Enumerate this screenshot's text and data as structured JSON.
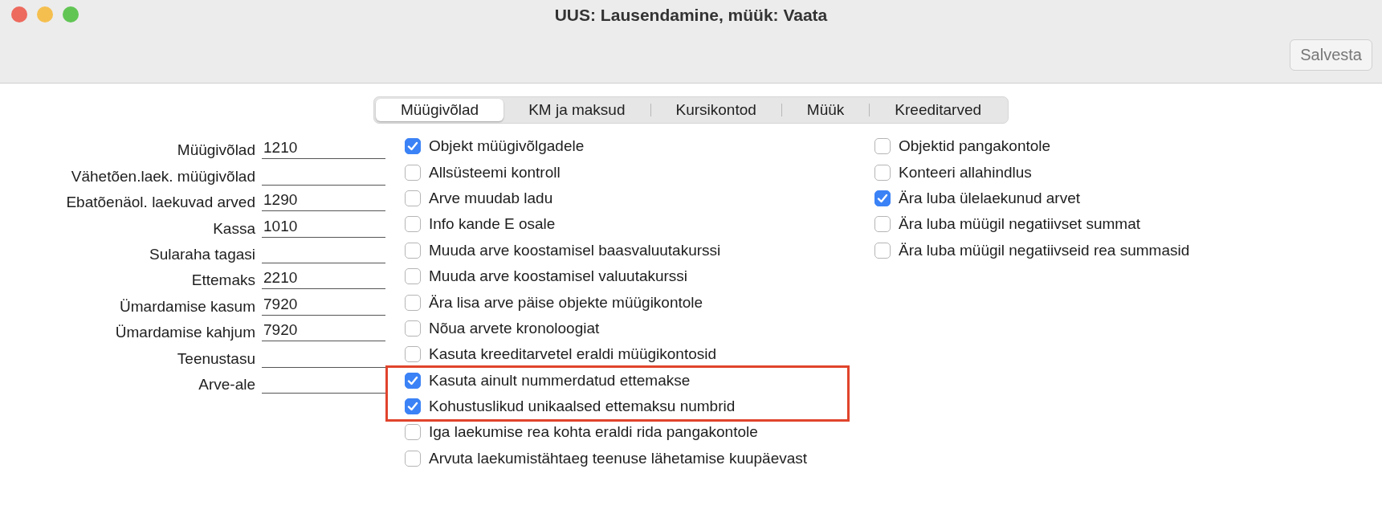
{
  "window": {
    "title": "UUS: Lausendamine, müük: Vaata"
  },
  "toolbar": {
    "save_button": "Salvesta"
  },
  "tabs": [
    {
      "label": "Müügivõlad",
      "selected": true
    },
    {
      "label": "KM ja maksud",
      "selected": false
    },
    {
      "label": "Kursikontod",
      "selected": false
    },
    {
      "label": "Müük",
      "selected": false
    },
    {
      "label": "Kreeditarved",
      "selected": false
    }
  ],
  "accounts": [
    {
      "label": "Müügivõlad",
      "value": "1210"
    },
    {
      "label": "Vähetõen.laek. müügivõlad"
    },
    {
      "label": "Ebatõenäol. laekuvad arved",
      "value": "1290"
    },
    {
      "label": "Kassa",
      "value": "1010"
    },
    {
      "label": "Sularaha tagasi"
    },
    {
      "label": "Ettemaks",
      "value": "2210"
    },
    {
      "label": "Ümardamise kasum",
      "value": "7920"
    },
    {
      "label": "Ümardamise kahjum",
      "value": "7920"
    },
    {
      "label": "Teenustasu"
    },
    {
      "label": "Arve-ale"
    }
  ],
  "options_middle": [
    {
      "label": "Objekt müügivõlgadele",
      "checked": true,
      "highlighted": false
    },
    {
      "label": "Allsüsteemi kontroll",
      "checked": false,
      "highlighted": false
    },
    {
      "label": "Arve muudab ladu",
      "checked": false,
      "highlighted": false
    },
    {
      "label": "Info kande E osale",
      "checked": false,
      "highlighted": false
    },
    {
      "label": "Muuda arve koostamisel baasvaluutakurssi",
      "checked": false,
      "highlighted": false
    },
    {
      "label": "Muuda arve koostamisel valuutakurssi",
      "checked": false,
      "highlighted": false
    },
    {
      "label": "Ära lisa arve päise objekte müügikontole",
      "checked": false,
      "highlighted": false
    },
    {
      "label": "Nõua arvete kronoloogiat",
      "checked": false,
      "highlighted": false
    },
    {
      "label": "Kasuta kreeditarvetel eraldi müügikontosid",
      "checked": false,
      "highlighted": false
    },
    {
      "label": "Kasuta ainult nummerdatud ettemakse",
      "checked": true,
      "highlighted": true
    },
    {
      "label": "Kohustuslikud unikaalsed ettemaksu numbrid",
      "checked": true,
      "highlighted": true
    },
    {
      "label": "Iga laekumise rea kohta eraldi rida pangakontole",
      "checked": false,
      "highlighted": false
    },
    {
      "label": "Arvuta laekumistähtaeg teenuse lähetamise kuupäevast",
      "checked": false,
      "highlighted": false
    }
  ],
  "options_right": [
    {
      "label": "Objektid pangakontole",
      "checked": false
    },
    {
      "label": "Konteeri allahindlus",
      "checked": false
    },
    {
      "label": "Ära luba ülelaekunud arvet",
      "checked": true
    },
    {
      "label": "Ära luba müügil negatiivset summat",
      "checked": false
    },
    {
      "label": "Ära luba müügil negatiivseid rea summasid",
      "checked": false
    }
  ]
}
